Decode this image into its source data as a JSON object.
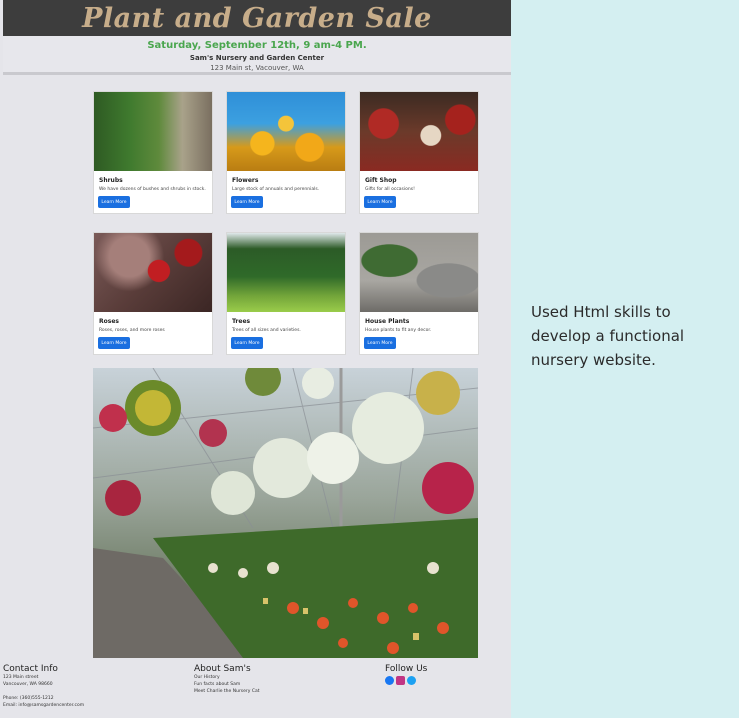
{
  "header": {
    "title": "Plant and Garden Sale",
    "date": "Saturday, September 12th, 9 am-4 PM.",
    "business": "Sam's Nursery and Garden Center",
    "address": "123 Main st, Vacouver, WA"
  },
  "cards": [
    {
      "title": "Shrubs",
      "desc": "We have dozens of bushes and shrubs in stock.",
      "button": "Learn More"
    },
    {
      "title": "Flowers",
      "desc": "Large stock of annuals and perennials.",
      "button": "Learn More"
    },
    {
      "title": "Gift Shop",
      "desc": "Gifts for all occasions!",
      "button": "Learn More"
    },
    {
      "title": "Roses",
      "desc": "Roses, roses, and more roses",
      "button": "Learn More"
    },
    {
      "title": "Trees",
      "desc": "Trees of all sizes and varieties.",
      "button": "Learn More"
    },
    {
      "title": "House Plants",
      "desc": "House plants to fit any decor.",
      "button": "Learn More"
    }
  ],
  "footer": {
    "contact": {
      "heading": "Contact Info",
      "street": "123 Main street",
      "city": "Vancouver, WA 98660",
      "phone": "Phone: (360)555-1212",
      "email": "Email: info@samsgardencenter.com"
    },
    "about": {
      "heading": "About Sam's",
      "links": [
        "Our History",
        "Fun facts about Sam",
        "Meet Charlie the Nursery Cat"
      ]
    },
    "follow": {
      "heading": "Follow Us",
      "icons": [
        "facebook-icon",
        "instagram-icon",
        "twitter-icon"
      ]
    }
  },
  "caption": "Used Html skills to develop a functional nursery website."
}
